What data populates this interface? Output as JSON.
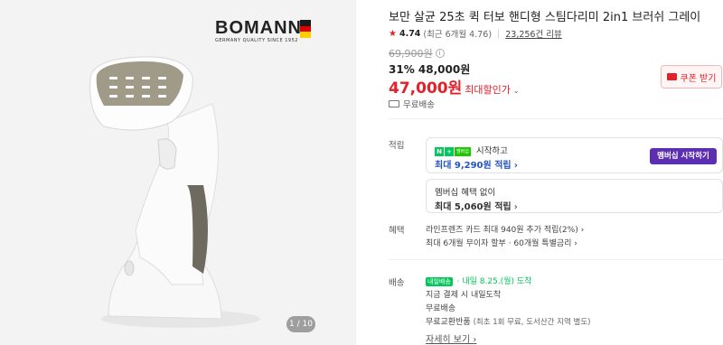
{
  "gallery": {
    "brand_name": "BOMANN",
    "brand_tagline": "GERMANY QUALITY SINCE 1952",
    "counter": "1 / 10",
    "flag_colors": [
      "#1a1a1a",
      "#dd0000",
      "#ffce00"
    ]
  },
  "product": {
    "title": "보만 살균 25초 퀵 터보 핸디형 스팀다리미 2in1 브러쉬 그레이",
    "rating": "4.74",
    "rating_recent": "(최근 6개월 4.76)",
    "reviews": "23,256건 리뷰"
  },
  "price": {
    "original": "69,900원",
    "discount_rate": "31%",
    "sale": "48,000원",
    "max_price": "47,000원",
    "max_label": "최대할인가"
  },
  "coupon": {
    "label": "쿠폰 받기"
  },
  "shipping": {
    "label": "무료배송"
  },
  "points": {
    "section_label": "적립",
    "np_text": "멤버십",
    "start_text": "시작하고",
    "max_points": "최대 9,290원 적립",
    "member_button": "멤버십 시작하기",
    "no_member_text": "멤버십 혜택 없이",
    "no_member_points": "최대 5,060원 적립"
  },
  "benefits": {
    "section_label": "혜택",
    "line1": "라인프렌즈 카드 최대 940원 추가 적립(2%)",
    "line2": "최대 6개월 무이자 할부 · 60개월 특별금리"
  },
  "delivery": {
    "section_label": "배송",
    "badge": "내일배송",
    "arrive": "· 내일 8.25.(월) 도착",
    "line2": "지금 결제 시 내일도착",
    "line3": "무료배송",
    "line4_main": "무료교환반품",
    "line4_note": "(최초 1회 무료, 도서산간 지역 별도)",
    "more": "자세히 보기"
  },
  "colors": {
    "accent_red": "#e4202b",
    "naver_green": "#03c75a",
    "member_purple": "#5b2fb0",
    "link_blue": "#2452c8"
  }
}
